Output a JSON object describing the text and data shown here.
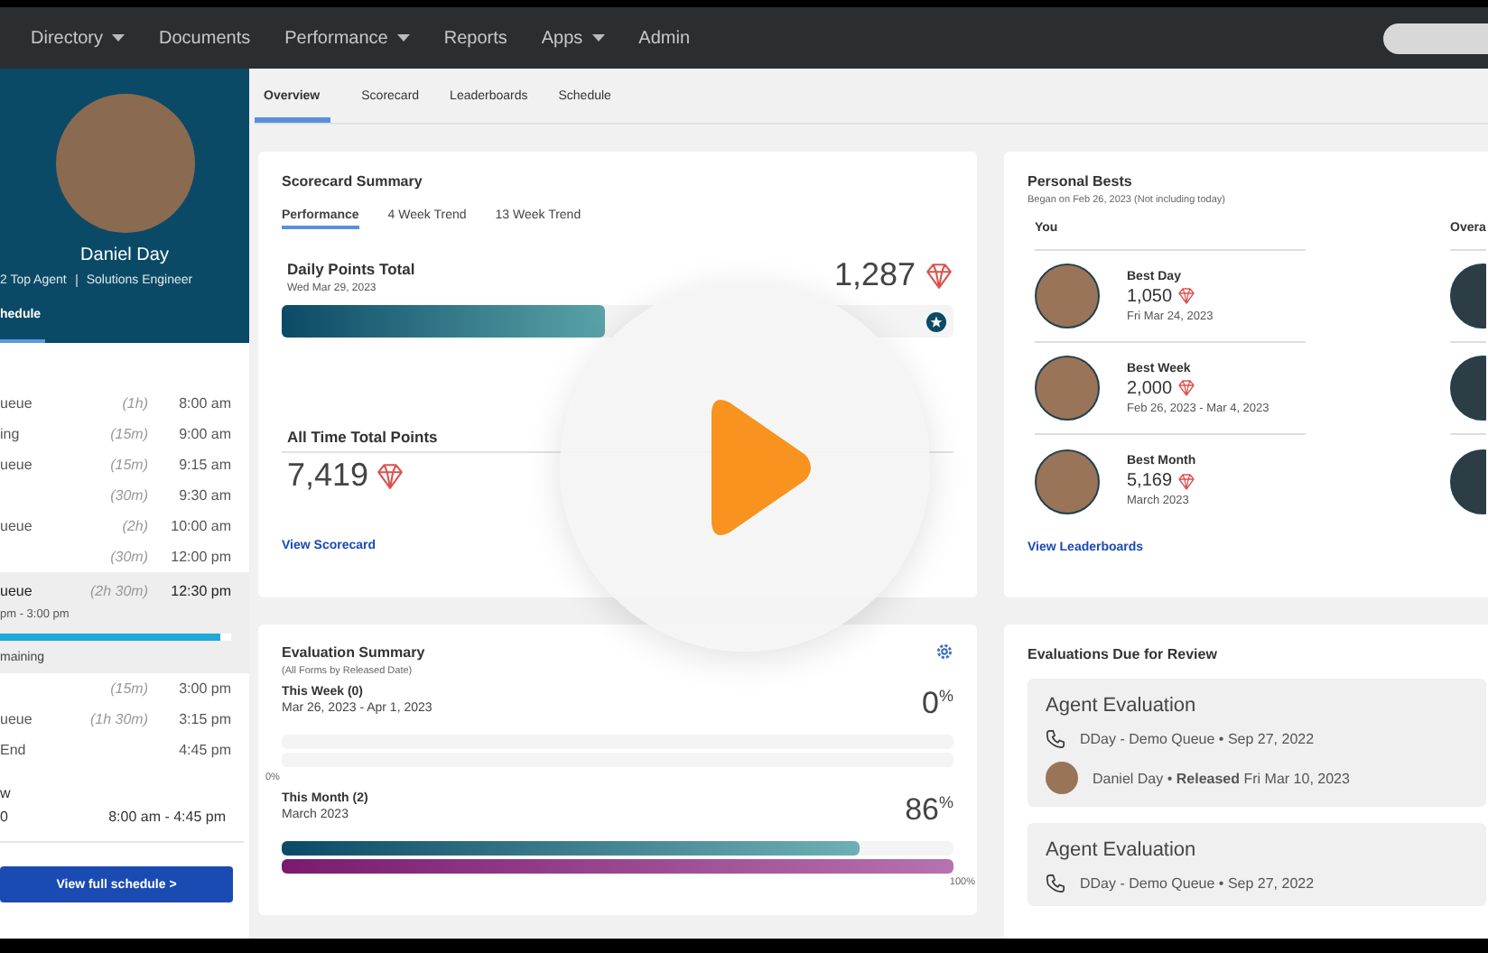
{
  "nav": {
    "items": [
      {
        "label": "Directory",
        "dropdown": true
      },
      {
        "label": "Documents",
        "dropdown": false
      },
      {
        "label": "Performance",
        "dropdown": true
      },
      {
        "label": "Reports",
        "dropdown": false
      },
      {
        "label": "Apps",
        "dropdown": true
      },
      {
        "label": "Admin",
        "dropdown": false
      }
    ]
  },
  "profile": {
    "name": "Daniel Day",
    "role": "2 Top Agent",
    "title": "Solutions Engineer",
    "tab": "hedule"
  },
  "schedule": {
    "rows": [
      {
        "kind": "item",
        "name": "ueue",
        "duration": "(1h)",
        "time": "8:00 am"
      },
      {
        "kind": "item",
        "name": "ing",
        "duration": "(15m)",
        "time": "9:00 am"
      },
      {
        "kind": "item",
        "name": "ueue",
        "duration": "(15m)",
        "time": "9:15 am"
      },
      {
        "kind": "item",
        "duration": "(30m)",
        "time": "9:30 am"
      },
      {
        "kind": "item",
        "name": "ueue",
        "duration": "(2h)",
        "time": "10:00 am"
      },
      {
        "kind": "item",
        "duration": "(30m)",
        "time": "12:00 pm"
      },
      {
        "kind": "current",
        "name": "ueue",
        "duration": "(2h 30m)",
        "time": "12:30 pm",
        "range": "pm - 3:00 pm",
        "level": 0.95,
        "remaining": "maining"
      },
      {
        "kind": "item",
        "duration": "(15m)",
        "time": "3:00 pm"
      },
      {
        "kind": "item",
        "name": "ueue",
        "duration": "(1h 30m)",
        "time": "3:15 pm"
      },
      {
        "kind": "item",
        "name": "End",
        "time": "4:45 pm"
      }
    ],
    "summary": {
      "label": "w",
      "value": "0",
      "range": "8:00 am - 4:45 pm"
    },
    "button": "View full schedule >"
  },
  "tabs": [
    {
      "label": "Overview",
      "selected": true
    },
    {
      "label": "Scorecard",
      "selected": false
    },
    {
      "label": "Leaderboards",
      "selected": false
    },
    {
      "label": "Schedule",
      "selected": false
    }
  ],
  "scorecard": {
    "title": "Scorecard Summary",
    "tabs": [
      {
        "label": "Performance",
        "selected": true
      },
      {
        "label": "4 Week Trend",
        "selected": false
      },
      {
        "label": "13 Week Trend",
        "selected": false
      }
    ],
    "daily": {
      "label": "Daily Points Total",
      "date": "Wed Mar 29, 2023",
      "value": "1,287",
      "level": 0.48
    },
    "all_time": {
      "label": "All Time Total Points",
      "value": "7,419"
    },
    "link": "View Scorecard"
  },
  "personal_bests": {
    "title": "Personal Bests",
    "subtitle": "Began on Feb 26, 2023 (Not including today)",
    "col_you": "You",
    "col_overall": "Overa",
    "items": [
      {
        "label": "Best Day",
        "value": "1,050",
        "date": "Fri Mar 24, 2023"
      },
      {
        "label": "Best Week",
        "value": "2,000",
        "date": "Feb 26, 2023 - Mar 4, 2023"
      },
      {
        "label": "Best Month",
        "value": "5,169",
        "date": "March 2023"
      }
    ],
    "link": "View Leaderboards"
  },
  "evaluation_summary": {
    "title": "Evaluation Summary",
    "subtitle": "(All Forms by Released Date)",
    "periods": [
      {
        "label": "This Week (0)",
        "dates": "Mar 26, 2023 - Apr 1, 2023",
        "percent": "0$^{%}$",
        "bars": [
          {
            "level": 0
          },
          {
            "level": 0
          }
        ]
      },
      {
        "label": "This Month (2)",
        "dates": "March 2023",
        "percent": "86$^{%}$",
        "bars": [
          {
            "level": 0.86
          },
          {
            "level": 1
          }
        ]
      }
    ],
    "scale": {
      "min": "0%",
      "max": "100%"
    }
  },
  "evaluations_due": {
    "title": "Evaluations Due for Review",
    "items": [
      {
        "title": "Agent Evaluation",
        "call": "DDay - Demo Queue • Sep 27, 2022",
        "reviewer": "Daniel Day • **Released** Fri Mar 10, 2023"
      },
      {
        "title": "Agent Evaluation",
        "call": "DDay - Demo Queue • Sep 27, 2022"
      }
    ]
  }
}
